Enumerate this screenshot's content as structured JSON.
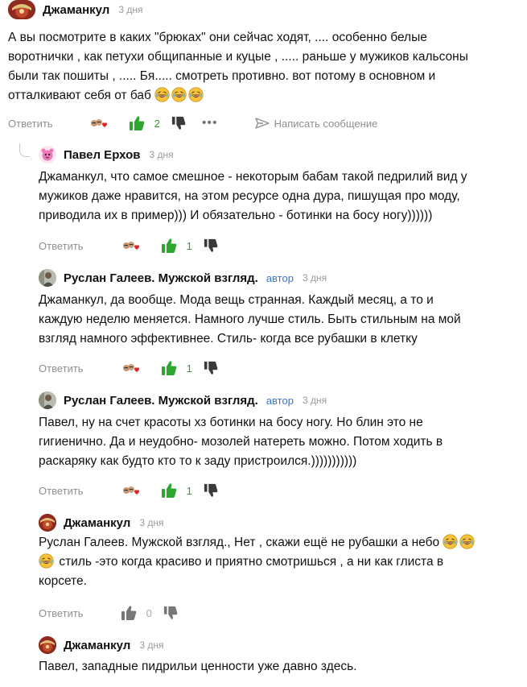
{
  "comments": [
    {
      "author": "Джаманкул",
      "time": "3 дня",
      "lines": [
        "А вы посмотрите в каких \"брюках\" они сейчас ходят, .... особенно белые",
        "воротнички , как петухи общипанные и куцые , ..... раньше у мужиков кальсоны",
        "были так пошиты , ..... Бя..... смотреть противно. вот потому в основном и",
        "отталкивают себя от баб"
      ],
      "emoji_count": 3,
      "reply_label": "Ответить",
      "likes": "2",
      "message_label": "Написать сообщение"
    },
    {
      "author": "Павел Ерхов",
      "time": "3 дня",
      "lines": [
        "Джаманкул, что самое смешное - некоторым бабам такой педрилий вид у",
        "мужиков даже нравится, на этом ресурсе одна дура, пишущая про моду,",
        "приводила их в пример))) И обязательно - ботинки на босу ногу))))))"
      ],
      "reply_label": "Ответить",
      "likes": "1"
    },
    {
      "author": "Руслан Галеев. Мужской взгляд.",
      "author_tag": "автор",
      "time": "3 дня",
      "lines": [
        "Джаманкул, да вообще. Мода вещь странная. Каждый месяц, а то и",
        "каждую неделю меняется. Намного лучше стиль. Быть стильным на мой",
        "взгляд намного эффективнее. Стиль- когда все рубашки в клетку"
      ],
      "reply_label": "Ответить",
      "likes": "1"
    },
    {
      "author": "Руслан Галеев. Мужской взгляд.",
      "author_tag": "автор",
      "time": "3 дня",
      "lines": [
        "Павел, ну на счет красоты хз ботинки на босу ногу. Но блин это не",
        "гигиенично. Да и неудобно- мозолей натереть можно. Потом ходить в",
        "раскаряку как будто кто то к заду пристроился.)))))))))))"
      ],
      "reply_label": "Ответить",
      "likes": "1"
    },
    {
      "author": "Джаманкул",
      "time": "3 дня",
      "lines": [
        "Руслан Галеев. Мужской взгляд., Нет , скажи ещё не рубашки а небо",
        "стиль -это когда красиво и приятно смотришься , а ни как глиста в",
        "корсете."
      ],
      "reply_label": "Ответить",
      "likes": "0"
    },
    {
      "author": "Джаманкул",
      "time": "3 дня",
      "lines": [
        "Павел, западные пидрильи ценности уже давно здесь."
      ]
    }
  ],
  "colors": {
    "like_green": "#2ea52e",
    "author_tag": "#3a76c9",
    "muted": "#8f8f8f"
  },
  "icons": [
    "thumb-up-icon",
    "thumb-down-icon",
    "reaction-icon",
    "more-icon",
    "send-message-icon",
    "laugh-emoji-icon"
  ]
}
